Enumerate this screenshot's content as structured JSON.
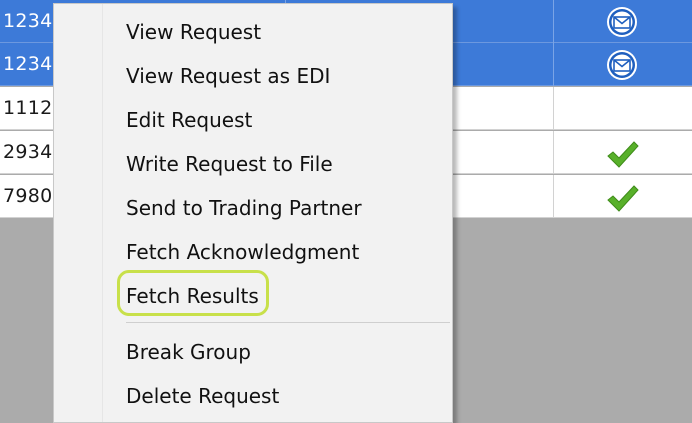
{
  "grid": {
    "rows": [
      {
        "id": "1234",
        "selected": true,
        "status_icon": "envelope-icon"
      },
      {
        "id": "1234",
        "selected": true,
        "status_icon": "envelope-icon"
      },
      {
        "id": "1112",
        "selected": false,
        "status_icon": ""
      },
      {
        "id": "2934",
        "selected": false,
        "status_icon": "checkmark-icon"
      },
      {
        "id": "7980",
        "selected": false,
        "status_icon": "checkmark-icon"
      }
    ],
    "colors": {
      "selection": "#3d7ad8",
      "empty_area": "#ababab",
      "checkmark": "#58b02a"
    }
  },
  "context_menu": {
    "items": [
      {
        "label": "View Request"
      },
      {
        "label": "View Request as EDI"
      },
      {
        "label": "Edit Request"
      },
      {
        "label": "Write Request to File"
      },
      {
        "label": "Send to Trading Partner"
      },
      {
        "label": "Fetch Acknowledgment"
      },
      {
        "label": "Fetch Results",
        "highlighted": true
      },
      {
        "label": "Break Group"
      },
      {
        "label": "Delete Request"
      }
    ],
    "highlight_color": "#c8e04a"
  }
}
